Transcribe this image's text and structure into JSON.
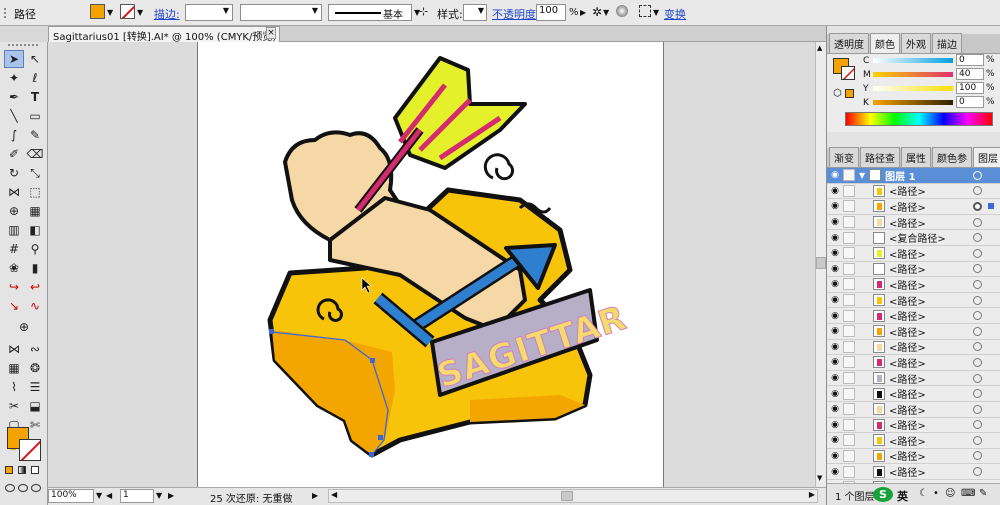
{
  "control_bar": {
    "object_type": "路径",
    "stroke_label": "描边:",
    "stroke_style": "基本",
    "style_label": "样式:",
    "opacity_label": "不透明度:",
    "opacity_value": "100",
    "opacity_unit": "%",
    "transform_label": "变换",
    "fill_color": "#f5a300"
  },
  "document_tab": {
    "title": "Sagittarius01 [转换].AI* @ 100% (CMYK/预览)",
    "close": "×"
  },
  "status_bar": {
    "zoom": "100%",
    "page": "1",
    "undo_info": "25 次还原: 无重做"
  },
  "color_panel": {
    "tabs": [
      "透明度",
      "颜色",
      "外观",
      "描边"
    ],
    "active_tab": "颜色",
    "fill_color": "#f5a300",
    "channels": [
      {
        "label": "C",
        "value": "0"
      },
      {
        "label": "M",
        "value": "40"
      },
      {
        "label": "Y",
        "value": "100"
      },
      {
        "label": "K",
        "value": "0"
      }
    ]
  },
  "layers_panel": {
    "tabs": [
      "渐变",
      "路径查",
      "属性",
      "颜色参",
      "图层"
    ],
    "active_tab": "图层",
    "layer_name": "图层 1",
    "items": [
      "<路径>",
      "<路径>",
      "<路径>",
      "<复合路径>",
      "<路径>",
      "<路径>",
      "<路径>",
      "<路径>",
      "<路径>",
      "<路径>",
      "<路径>",
      "<路径>",
      "<路径>",
      "<路径>",
      "<路径>",
      "<路径>",
      "<路径>",
      "<路径>",
      "<路径>",
      "<路径>"
    ],
    "footer": "1 个图层",
    "ime_label": "英"
  },
  "artwork": {
    "banner_text": "SAGITTAR",
    "colors": {
      "star": "#f8c40a",
      "star_shade": "#f4a600",
      "skin": "#f6d7a6",
      "arrow_blue": "#2f7fd0",
      "fletch": "#e4f02a",
      "fletch_stripe": "#d62a6e",
      "banner": "#b7aec8"
    }
  }
}
